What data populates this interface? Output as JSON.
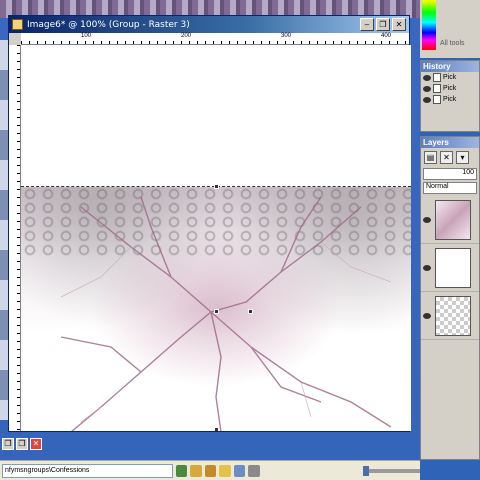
{
  "window": {
    "title": "Image6* @ 100% (Group - Raster 3)",
    "minimize_glyph": "–",
    "restore_glyph": "❐",
    "close_glyph": "✕"
  },
  "ruler": {
    "marks": [
      "100",
      "200",
      "300",
      "400"
    ]
  },
  "palette": {
    "all_tools_label": "All tools"
  },
  "history": {
    "title": "History",
    "items": [
      {
        "label": "Pick"
      },
      {
        "label": "Pick"
      },
      {
        "label": "Pick"
      }
    ]
  },
  "layers": {
    "title": "Layers",
    "opacity": "100",
    "blend_mode": "Normal"
  },
  "taskbar": {
    "address": "nfymsngroups\\Confessions"
  },
  "colors": {
    "accent": "#0a246a",
    "workspace": "#3a68c0",
    "lightning": "#a26a8a"
  }
}
